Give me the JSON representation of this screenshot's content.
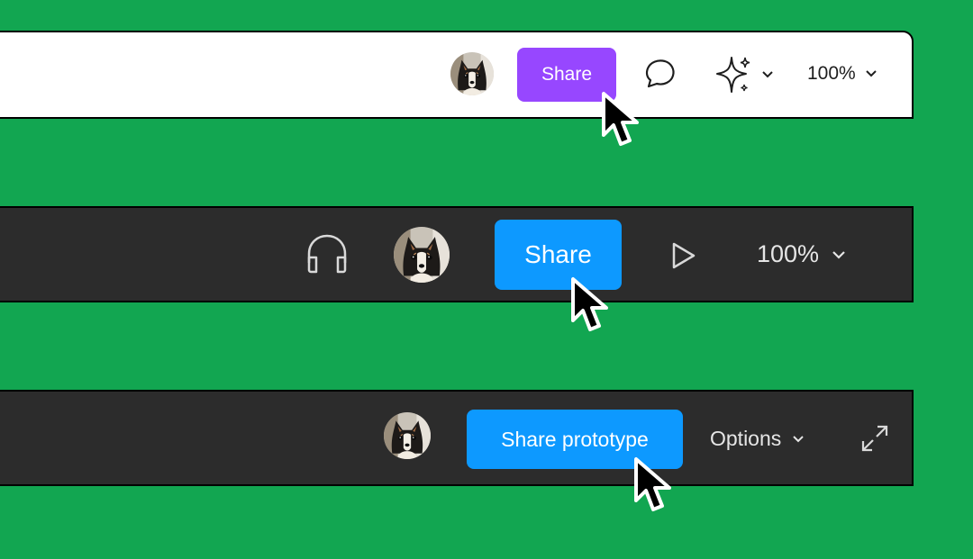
{
  "bar1": {
    "share_label": "Share",
    "zoom_label": "100%",
    "button_color": "#9747ff",
    "background": "#ffffff"
  },
  "bar2": {
    "share_label": "Share",
    "zoom_label": "100%",
    "button_color": "#0d99ff",
    "background": "#2c2c2c"
  },
  "bar3": {
    "share_label": "Share prototype",
    "options_label": "Options",
    "button_color": "#0d99ff",
    "background": "#2c2c2c"
  },
  "page": {
    "background": "#12a651"
  },
  "icons": [
    "avatar",
    "comment-icon",
    "sparkle-icon",
    "chevron-down-icon",
    "headphones-icon",
    "play-icon",
    "expand-icon",
    "cursor-icon"
  ]
}
